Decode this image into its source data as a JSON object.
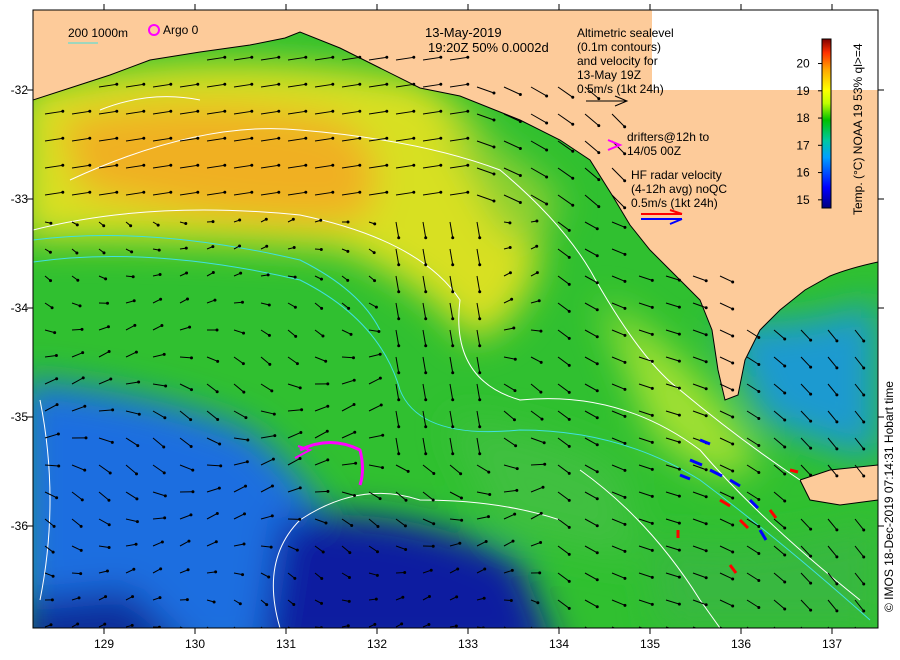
{
  "header": {
    "date": "13-May-2019",
    "time_info": "19:20Z  50% 0.0002d",
    "depth_legend": "200  1000m",
    "argo_legend": "Argo 0"
  },
  "legend": {
    "altimetry": [
      "Altimetric sealevel",
      "(0.1m contours)",
      "and velocity for",
      "13-May 19Z",
      "0.5m/s (1kt 24h)"
    ],
    "drifters": [
      "drifters@12h to",
      "14/05 00Z"
    ],
    "hf_radar": [
      "HF radar velocity",
      "(4-12h avg) noQC",
      "0.5m/s (1kt 24h)"
    ]
  },
  "colorbar": {
    "label": "Temp. (°C) NOAA 19 53% ql>=4",
    "ticks": [
      "15",
      "16",
      "17",
      "18",
      "19",
      "20"
    ],
    "range": [
      14.7,
      20.9
    ],
    "colors": [
      "#00007f",
      "#0000ff",
      "#00bfff",
      "#00c060",
      "#00c000",
      "#c0ff00",
      "#ffff00",
      "#ffa500",
      "#ff4000",
      "#7f0000"
    ]
  },
  "axes": {
    "lon_ticks": [
      "129",
      "130",
      "131",
      "132",
      "133",
      "134",
      "135",
      "136",
      "137"
    ],
    "lat_ticks": [
      "-32",
      "-33",
      "-34",
      "-35",
      "-36"
    ]
  },
  "credit": "© IMOS 18-Dec-2019 07:14:31 Hobart time",
  "colors": {
    "land": "#fdcb9a",
    "drifter": "#ff00ff",
    "hf_red": "#ff0000",
    "hf_blue": "#0000ff",
    "contour": "#ffffff",
    "isobath": "#40e0e0"
  }
}
